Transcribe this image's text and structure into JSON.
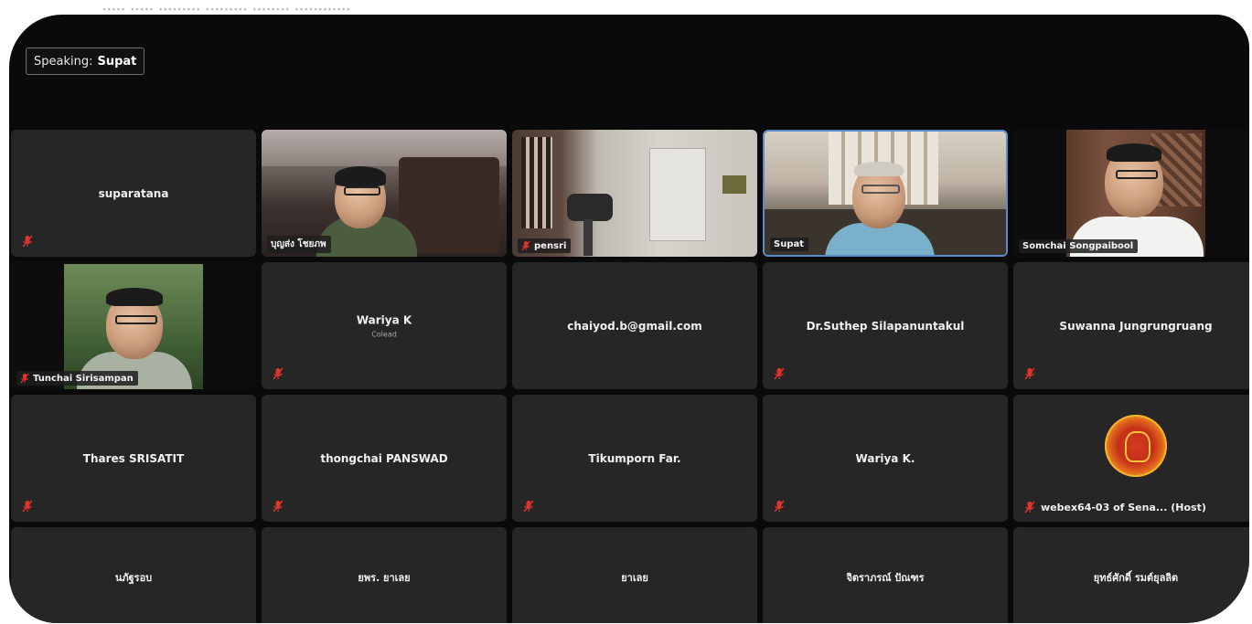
{
  "top_strip_text": "..... ..... ......... ......... ........ ............",
  "speaking": {
    "prefix": "Speaking:",
    "name": "Supat"
  },
  "tiles": [
    {
      "name": "suparatana",
      "type": "name",
      "muted": true
    },
    {
      "name": "บุญส่ง โชยภพ",
      "type": "video",
      "muted": false
    },
    {
      "name": "pensri",
      "type": "video",
      "muted": true
    },
    {
      "name": "Supat",
      "type": "video",
      "muted": false,
      "active": true
    },
    {
      "name": "Somchai Songpaibool",
      "type": "video",
      "muted": false
    },
    {
      "name": "Tunchai Sirisampan",
      "type": "video",
      "muted": true
    },
    {
      "name": "Wariya K",
      "sub": "Colead",
      "type": "name",
      "muted": true
    },
    {
      "name": "chaiyod.b@gmail.com",
      "type": "name",
      "muted": false
    },
    {
      "name": "Dr.Suthep Silapanuntakul",
      "type": "name",
      "muted": true
    },
    {
      "name": "Suwanna Jungrungruang",
      "type": "name",
      "muted": true
    },
    {
      "name": "Thares SRISATIT",
      "type": "name",
      "muted": true
    },
    {
      "name": "thongchai PANSWAD",
      "type": "name",
      "muted": true
    },
    {
      "name": "Tikumporn Far.",
      "type": "name",
      "muted": true
    },
    {
      "name": "Wariya K.",
      "type": "name",
      "muted": true
    },
    {
      "name": "webex64-03 of Sena... (Host)",
      "type": "logo",
      "muted": true
    },
    {
      "name": "นภัฐรอบ",
      "type": "name",
      "muted": false
    },
    {
      "name": "ยพร. ยาเลย",
      "type": "name",
      "muted": false
    },
    {
      "name": "ยาเลย",
      "type": "name",
      "muted": false
    },
    {
      "name": "จิตราภรณ์ ปัณฑร",
      "type": "name",
      "muted": false
    },
    {
      "name": "ยุทธ์ศักดิ์ รมต์ยุลลิต",
      "type": "name",
      "muted": false
    }
  ],
  "colors": {
    "active_border": "#5a8ccc",
    "tile_bg": "#262626",
    "mute_icon": "#e0342a"
  }
}
